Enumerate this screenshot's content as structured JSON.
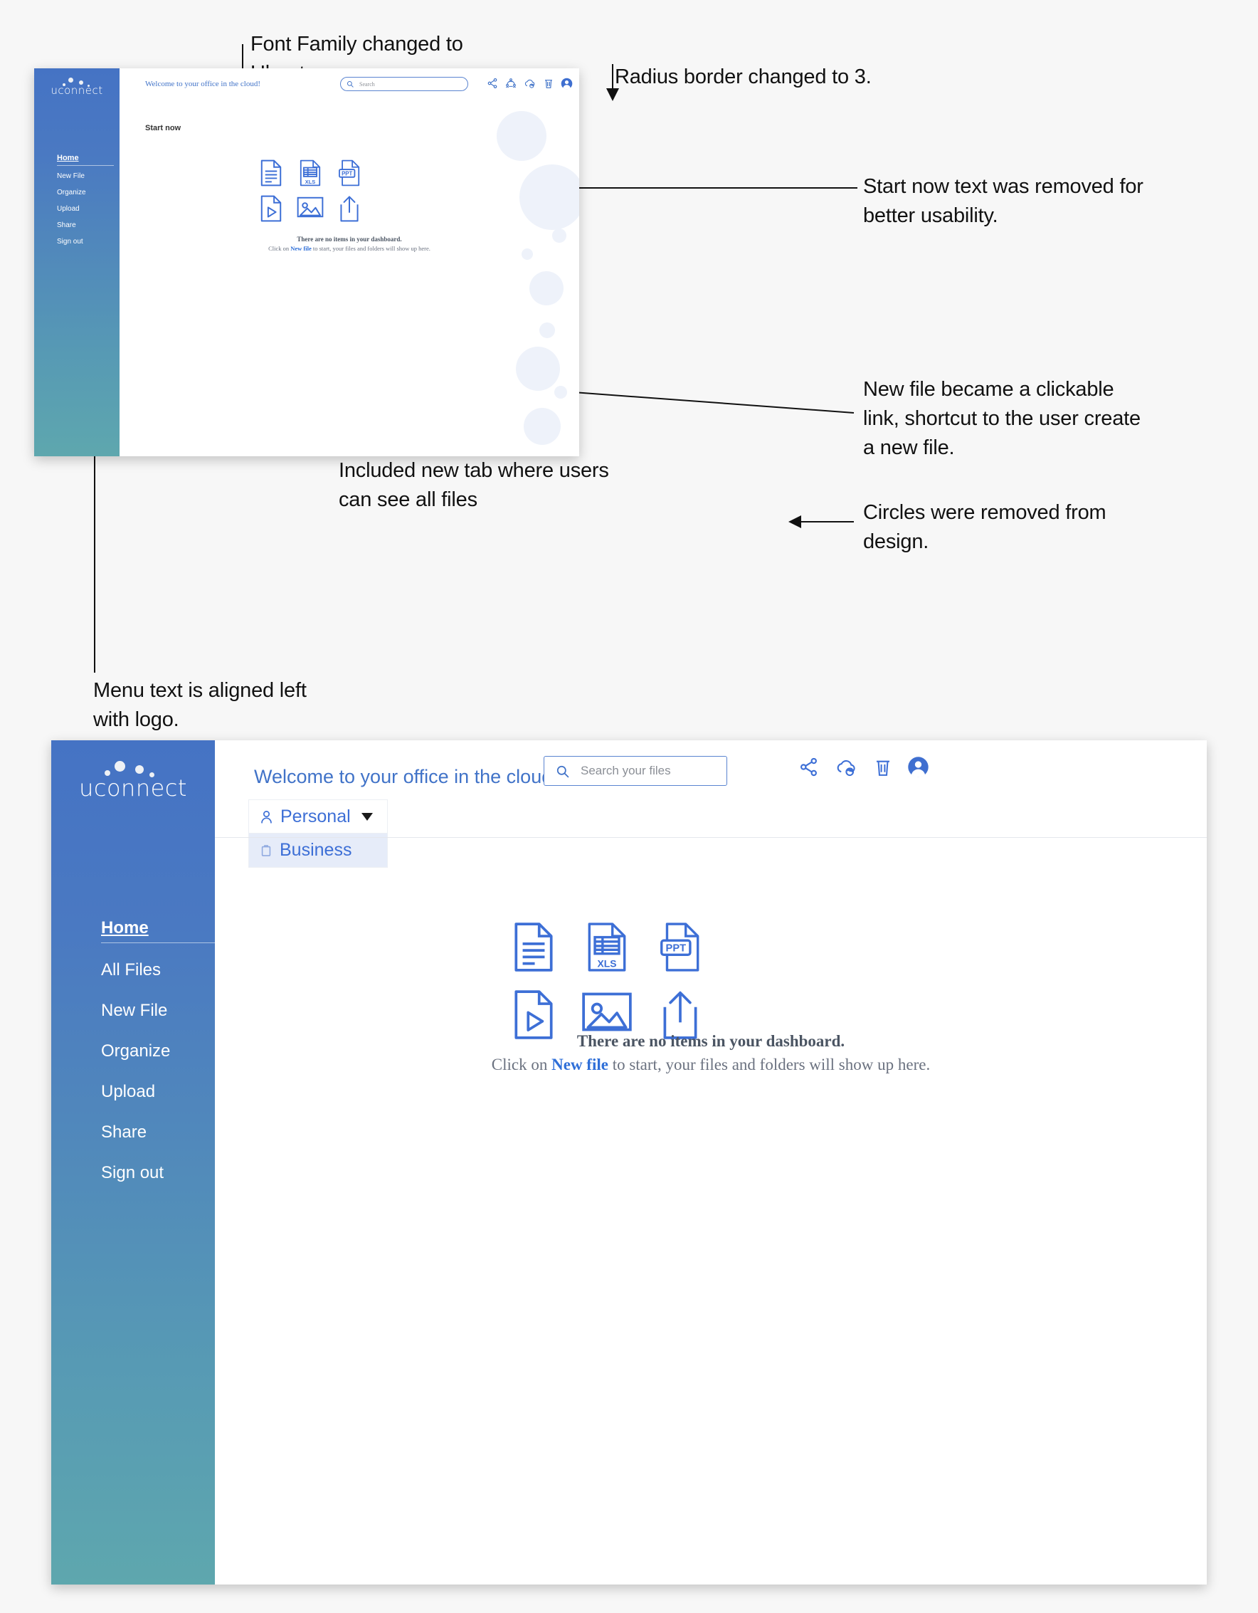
{
  "annotations": [
    {
      "id": "font-family",
      "text": "Font Family changed to\nUbuntu."
    },
    {
      "id": "radius-border",
      "text": "Radius border changed to 3."
    },
    {
      "id": "start-now",
      "text": "Start now text was removed for\nbetter usability."
    },
    {
      "id": "new-file-link",
      "text": "New file became a clickable\nlink, shortcut to the user create\na new file."
    },
    {
      "id": "new-tab",
      "text": "Included new tab where users\ncan see all files"
    },
    {
      "id": "circles",
      "text": "Circles were removed from\ndesign."
    },
    {
      "id": "menu-align",
      "text": "Menu text is aligned left\nwith logo."
    }
  ],
  "old_mockup": {
    "brand": "uconnect",
    "header": {
      "welcome": "Welcome to your office in the cloud!"
    },
    "search": {
      "placeholder": "Search",
      "icon": "search-icon"
    },
    "header_icons": [
      "share-icon",
      "collaborate-icon",
      "cloud-sync-icon",
      "trash-icon",
      "avatar-icon"
    ],
    "start_now_label": "Start now",
    "menu": [
      {
        "label": "Home",
        "active": true
      },
      {
        "label": "New File",
        "active": false
      },
      {
        "label": "Organize",
        "active": false
      },
      {
        "label": "Upload",
        "active": false
      },
      {
        "label": "Share",
        "active": false
      },
      {
        "label": "Sign out",
        "active": false
      }
    ],
    "file_icons": [
      "document-icon",
      "xls-icon",
      "ppt-icon",
      "video-icon",
      "image-icon",
      "upload-icon"
    ],
    "file_icon_labels": {
      "xls": "XLS",
      "ppt": "PPT"
    },
    "empty_state": {
      "title": "There are no items in your dashboard.",
      "prefix": "Click on ",
      "link": "New file",
      "suffix": " to start, your files and folders will show up here."
    }
  },
  "new_mockup": {
    "brand": "uconnect",
    "header": {
      "welcome": "Welcome to your office in the cloud!"
    },
    "search": {
      "placeholder": "Search your files",
      "icon": "search-icon"
    },
    "header_icons": [
      "share-icon",
      "cloud-sync-icon",
      "trash-icon",
      "avatar-icon"
    ],
    "tabs": [
      {
        "label": "Personal",
        "icon": "person-icon",
        "state": "selected"
      },
      {
        "label": "Business",
        "icon": "briefcase-icon",
        "state": "dropdown-item"
      }
    ],
    "menu": [
      {
        "label": "Home",
        "active": true
      },
      {
        "label": "All Files",
        "active": false
      },
      {
        "label": "New File",
        "active": false
      },
      {
        "label": "Organize",
        "active": false
      },
      {
        "label": "Upload",
        "active": false
      },
      {
        "label": "Share",
        "active": false
      },
      {
        "label": "Sign out",
        "active": false
      }
    ],
    "file_icons": [
      "document-icon",
      "xls-icon",
      "ppt-icon",
      "video-icon",
      "image-icon",
      "upload-icon"
    ],
    "file_icon_labels": {
      "xls": "XLS",
      "ppt": "PPT"
    },
    "empty_state": {
      "title": "There are no items in your dashboard.",
      "prefix": "Click on ",
      "link": "New file",
      "suffix": " to start, your files and folders will show up here."
    }
  },
  "colors": {
    "accent_blue": "#3d6fd6",
    "welcome_blue": "#4173c8",
    "sidebar_top": "#4573c4",
    "sidebar_bottom": "#5ea7ae",
    "page_bg": "#f7f7f7",
    "annotation_text": "#111111",
    "tab_hover_bg": "#e6ecf9"
  }
}
